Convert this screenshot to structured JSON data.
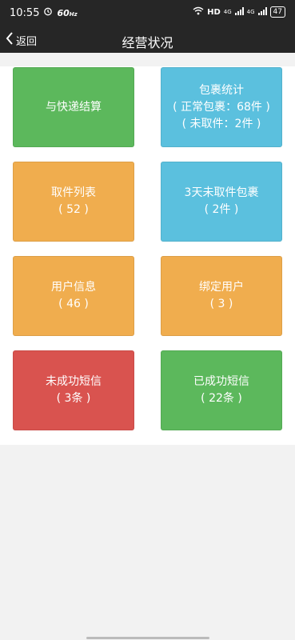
{
  "status_bar": {
    "time": "10:55",
    "net_speed": "60",
    "net_speed_unit": "Hz",
    "hd_label": "HD",
    "network_1": "4G",
    "network_2": "4G",
    "battery": "47"
  },
  "nav": {
    "back_label": "返回",
    "title": "经营状况"
  },
  "tiles": {
    "settlement": {
      "line1": "与快递结算",
      "color": "#5cb85c"
    },
    "package_stats": {
      "line1": "包裹统计",
      "line2": "( 正常包裹：68件 )",
      "line3": "( 未取件：2件 )",
      "color": "#5bc0de"
    },
    "pickup_list": {
      "line1": "取件列表",
      "line2": "( 52 )",
      "color": "#f0ad4e"
    },
    "three_day_unpicked": {
      "line1": "3天未取件包裹",
      "line2": "( 2件 )",
      "color": "#5bc0de"
    },
    "user_info": {
      "line1": "用户信息",
      "line2": "( 46 )",
      "color": "#f0ad4e"
    },
    "bind_user": {
      "line1": "绑定用户",
      "line2": "( 3 )",
      "color": "#f0ad4e"
    },
    "sms_failed": {
      "line1": "未成功短信",
      "line2": "( 3条 )",
      "color": "#d9534f"
    },
    "sms_success": {
      "line1": "已成功短信",
      "line2": "( 22条 )",
      "color": "#5cb85c"
    }
  }
}
